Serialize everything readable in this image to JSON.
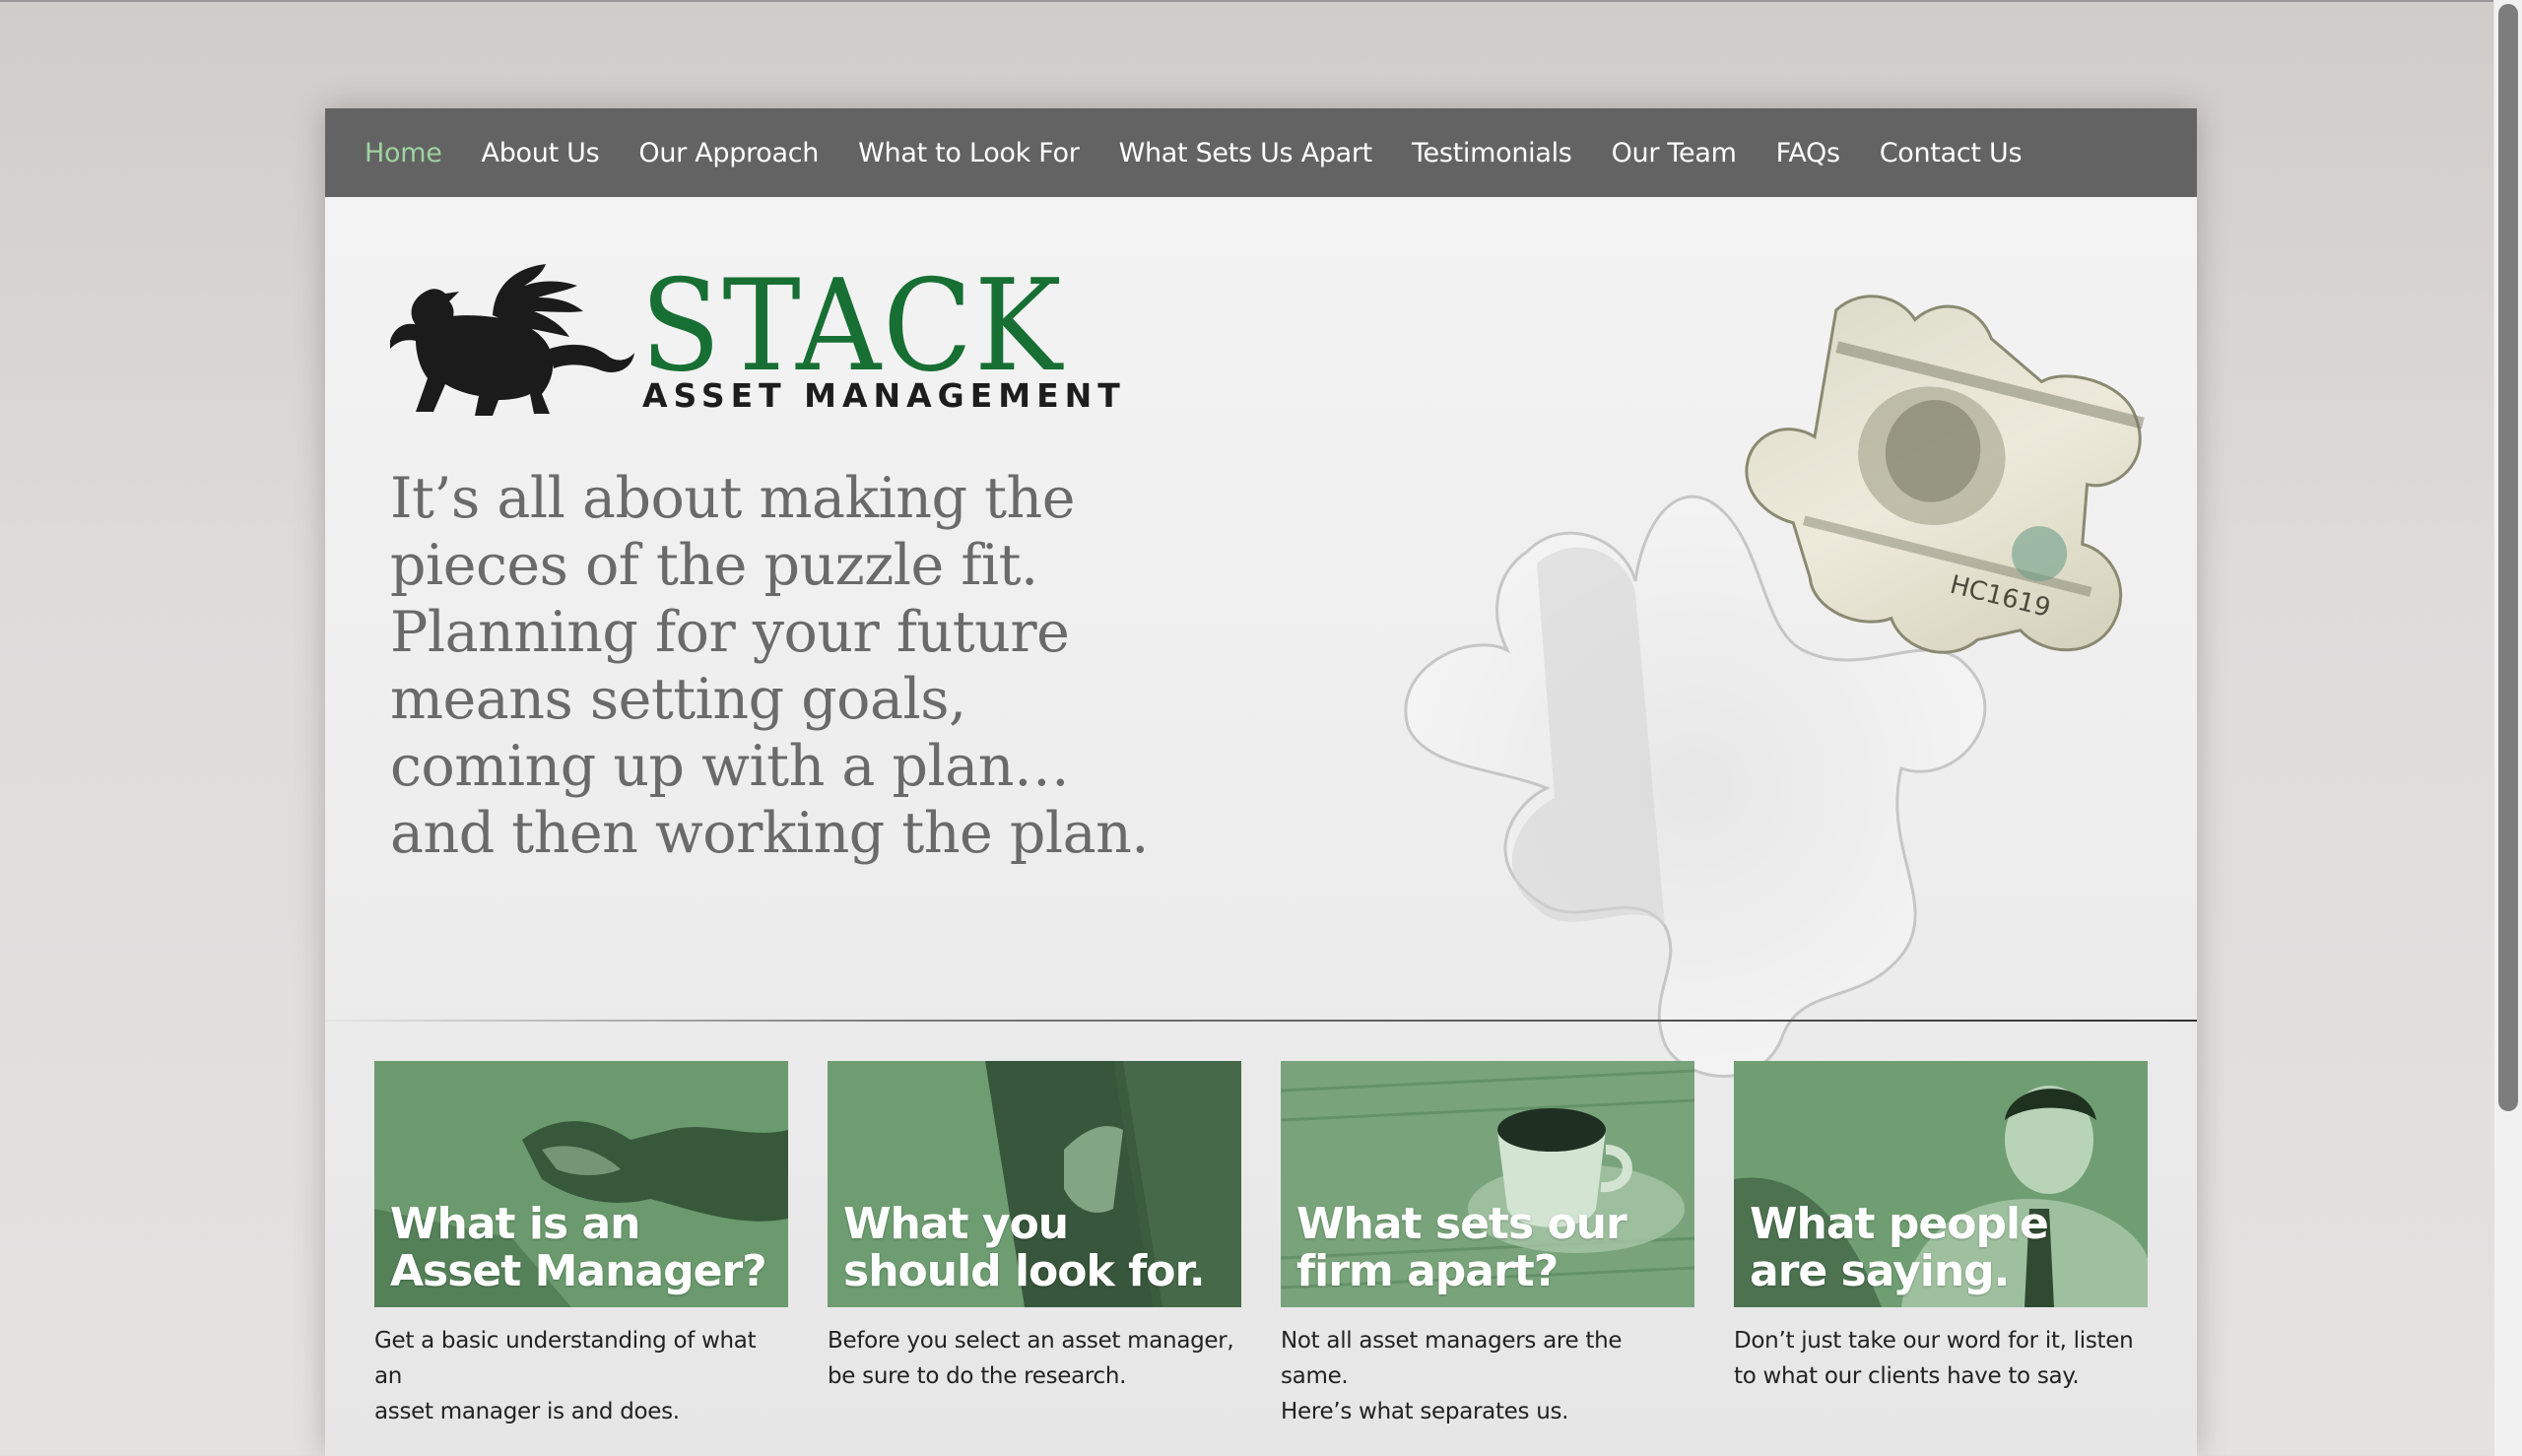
{
  "nav": {
    "items": [
      {
        "label": "Home",
        "active": true
      },
      {
        "label": "About Us"
      },
      {
        "label": "Our Approach"
      },
      {
        "label": "What to Look For"
      },
      {
        "label": "What Sets Us Apart"
      },
      {
        "label": "Testimonials"
      },
      {
        "label": "Our Team"
      },
      {
        "label": "FAQs"
      },
      {
        "label": "Contact Us"
      }
    ]
  },
  "logo": {
    "name": "STACK",
    "subtitle": "ASSET MANAGEMENT"
  },
  "hero": {
    "headline_lines": [
      "It’s all about making the",
      "pieces of the puzzle fit.",
      "Planning for your future",
      "means setting goals,",
      "coming up with a plan…",
      "and then working the plan."
    ],
    "bill_serial": "HC1619"
  },
  "cards": [
    {
      "title_lines": [
        "What is an",
        "Asset Manager?"
      ],
      "text_lines": [
        "Get a basic understanding of what an",
        "asset manager is and does."
      ]
    },
    {
      "title_lines": [
        "What you",
        "should look for."
      ],
      "text_lines": [
        "Before you select an asset manager,",
        "be sure to do the research."
      ]
    },
    {
      "title_lines": [
        "What sets our",
        "firm apart?"
      ],
      "text_lines": [
        "Not all asset managers are the same.",
        "Here’s what separates us."
      ]
    },
    {
      "title_lines": [
        "What people",
        "are saying."
      ],
      "text_lines": [
        "Don’t just take our word for it, listen",
        "to what our clients have to say."
      ]
    }
  ],
  "colors": {
    "nav_bg": "#636363",
    "nav_active": "#9fd39f",
    "brand_green": "#176f33",
    "card_green": "#6f9c72",
    "headline": "#6a6a6a"
  },
  "icons": {
    "logo_mark": "griffin-icon",
    "hero_image": "puzzle-piece-money"
  }
}
